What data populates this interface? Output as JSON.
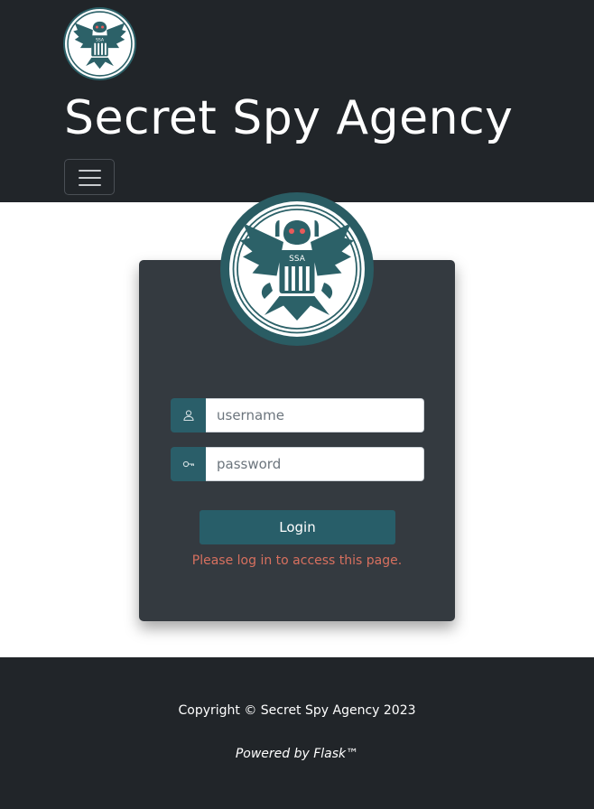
{
  "header": {
    "logo_icon": "eagle-seal-icon",
    "logo_text": "SSA",
    "title": "Secret Spy Agency",
    "menu_icon": "hamburger-menu-icon"
  },
  "login": {
    "logo_icon": "eagle-seal-icon",
    "logo_text": "SSA",
    "username": {
      "icon": "user-icon",
      "placeholder": "username",
      "value": ""
    },
    "password": {
      "icon": "key-icon",
      "placeholder": "password",
      "value": ""
    },
    "submit_label": "Login",
    "message": "Please log in to access this page."
  },
  "footer": {
    "copyright": "Copyright © Secret Spy Agency 2023",
    "powered_by": "Powered by Flask™"
  },
  "colors": {
    "header_bg": "#212529",
    "card_bg": "#343a40",
    "accent": "#285e69",
    "message": "#d7705f",
    "footer_bg": "#212529"
  }
}
